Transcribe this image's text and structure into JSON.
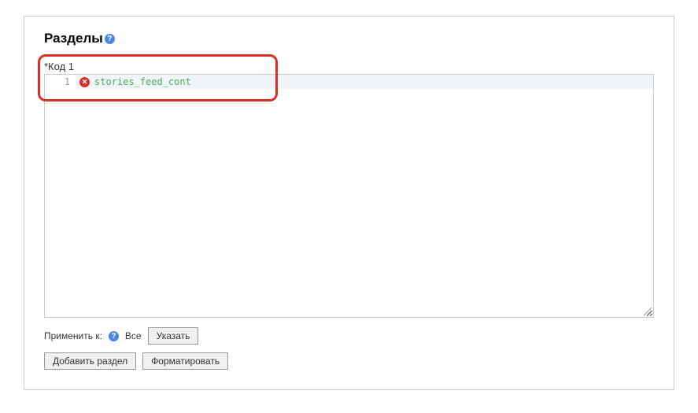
{
  "section": {
    "title": "Разделы"
  },
  "code": {
    "label": "*Код 1",
    "lineNumber": "1",
    "content": "stories_feed_cont"
  },
  "applyTo": {
    "label": "Применить к:",
    "all": "Все",
    "specify": "Указать"
  },
  "buttons": {
    "addSection": "Добавить раздел",
    "format": "Форматировать"
  }
}
